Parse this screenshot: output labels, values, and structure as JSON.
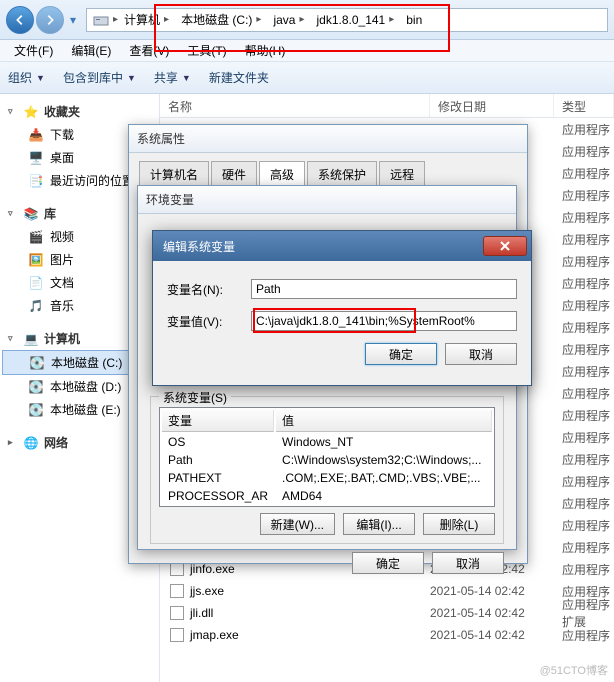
{
  "breadcrumb": {
    "segments": [
      "计算机",
      "本地磁盘 (C:)",
      "java",
      "jdk1.8.0_141",
      "bin"
    ]
  },
  "menubar": [
    "文件(F)",
    "编辑(E)",
    "查看(V)",
    "工具(T)",
    "帮助(H)"
  ],
  "toolbar": {
    "organize": "组织",
    "include": "包含到库中",
    "share": "共享",
    "newfolder": "新建文件夹"
  },
  "sidebar": {
    "fav": {
      "label": "收藏夹",
      "items": [
        "下载",
        "桌面",
        "最近访问的位置"
      ]
    },
    "lib": {
      "label": "库",
      "items": [
        "视频",
        "图片",
        "文档",
        "音乐"
      ]
    },
    "comp": {
      "label": "计算机",
      "items": [
        "本地磁盘 (C:)",
        "本地磁盘 (D:)",
        "本地磁盘 (E:)"
      ]
    },
    "net": {
      "label": "网络"
    }
  },
  "filelist": {
    "cols": {
      "name": "名称",
      "date": "修改日期",
      "type": "类型"
    },
    "type_app": "应用程序",
    "type_ext": "应用程序扩展",
    "rows": [
      {
        "name": "jinfo.exe",
        "date": "2021-05-14 02:42",
        "type": "应用程序"
      },
      {
        "name": "jjs.exe",
        "date": "2021-05-14 02:42",
        "type": "应用程序"
      },
      {
        "name": "jli.dll",
        "date": "2021-05-14 02:42",
        "type": "应用程序扩展"
      },
      {
        "name": "jmap.exe",
        "date": "2021-05-14 02:42",
        "type": "应用程序"
      }
    ]
  },
  "sysprops": {
    "title": "系统属性",
    "tabs": [
      "计算机名",
      "硬件",
      "高级",
      "系统保护",
      "远程"
    ],
    "envvar_title": "环境变量",
    "sysvar_group": "系统变量(S)",
    "cols": {
      "var": "变量",
      "val": "值"
    },
    "rows": [
      {
        "var": "OS",
        "val": "Windows_NT"
      },
      {
        "var": "Path",
        "val": "C:\\Windows\\system32;C:\\Windows;..."
      },
      {
        "var": "PATHEXT",
        "val": ".COM;.EXE;.BAT;.CMD;.VBS;.VBE;..."
      },
      {
        "var": "PROCESSOR_AR",
        "val": "AMD64"
      }
    ],
    "btns": {
      "new": "新建(W)...",
      "edit": "编辑(I)...",
      "delete": "删除(L)",
      "ok": "确定",
      "cancel": "取消"
    }
  },
  "editdlg": {
    "title": "编辑系统变量",
    "name_label": "变量名(N):",
    "name_value": "Path",
    "value_label": "变量值(V):",
    "value_value": "C:\\java\\jdk1.8.0_141\\bin;%SystemRoot%",
    "ok": "确定",
    "cancel": "取消"
  },
  "watermark": "@51CTO博客"
}
